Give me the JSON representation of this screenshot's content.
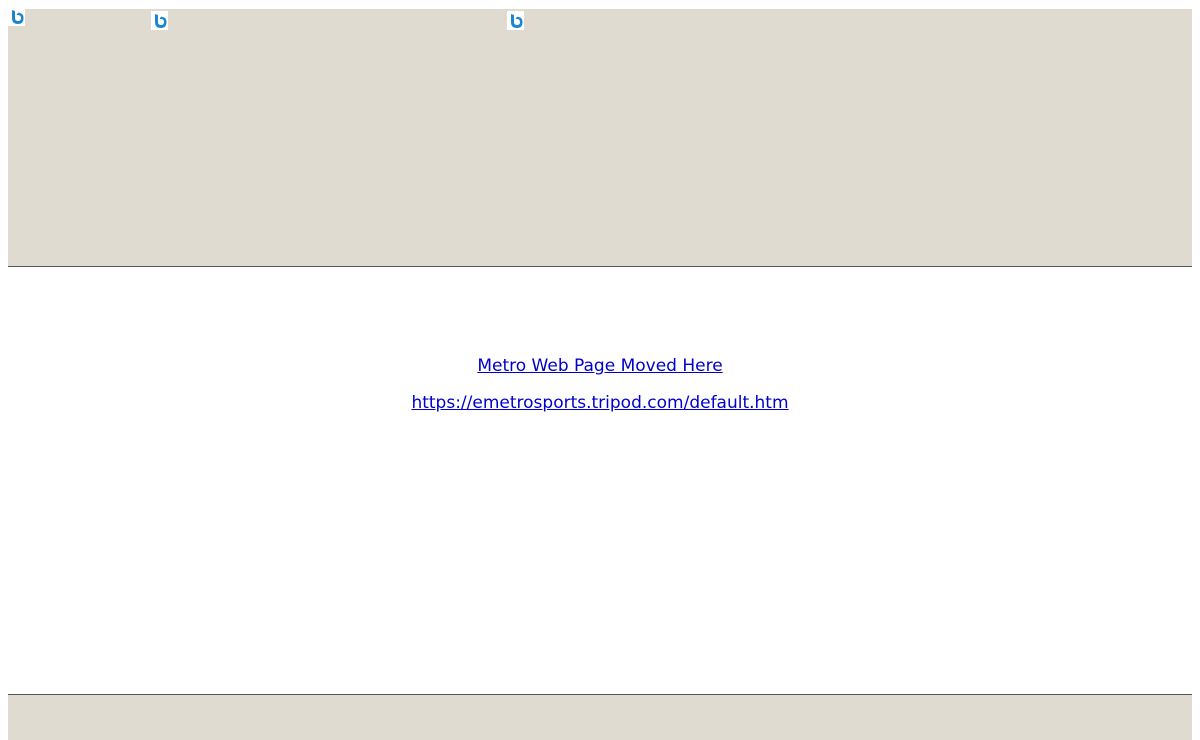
{
  "header": {
    "background_color": "#dfdbd0",
    "icons": [
      "bing-icon",
      "bing-icon",
      "bing-icon"
    ]
  },
  "main": {
    "moved_link_text": "Metro Web Page Moved Here",
    "url_link_text": "https://emetrosports.tripod.com/default.htm",
    "link_color": "#0000cc"
  },
  "footer": {
    "background_color": "#dfdbd0"
  }
}
